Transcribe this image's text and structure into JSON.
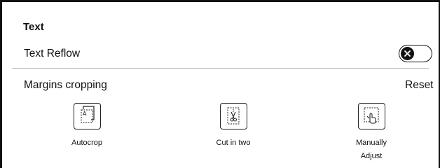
{
  "section": {
    "title": "Text"
  },
  "text_reflow": {
    "label": "Text Reflow",
    "enabled": false,
    "toggle_icon": "close-icon"
  },
  "margins": {
    "label": "Margins cropping",
    "reset_label": "Reset",
    "options": [
      {
        "label": "Autocrop",
        "icon": "autocrop-icon"
      },
      {
        "label": "Cut in two",
        "icon": "scissors-icon"
      },
      {
        "label_line1": "Manually",
        "label_line2": "Adjust",
        "icon": "manual-adjust-icon"
      }
    ]
  },
  "colors": {
    "text": "#111111",
    "divider": "#b8b8b8",
    "background": "#ffffff"
  }
}
